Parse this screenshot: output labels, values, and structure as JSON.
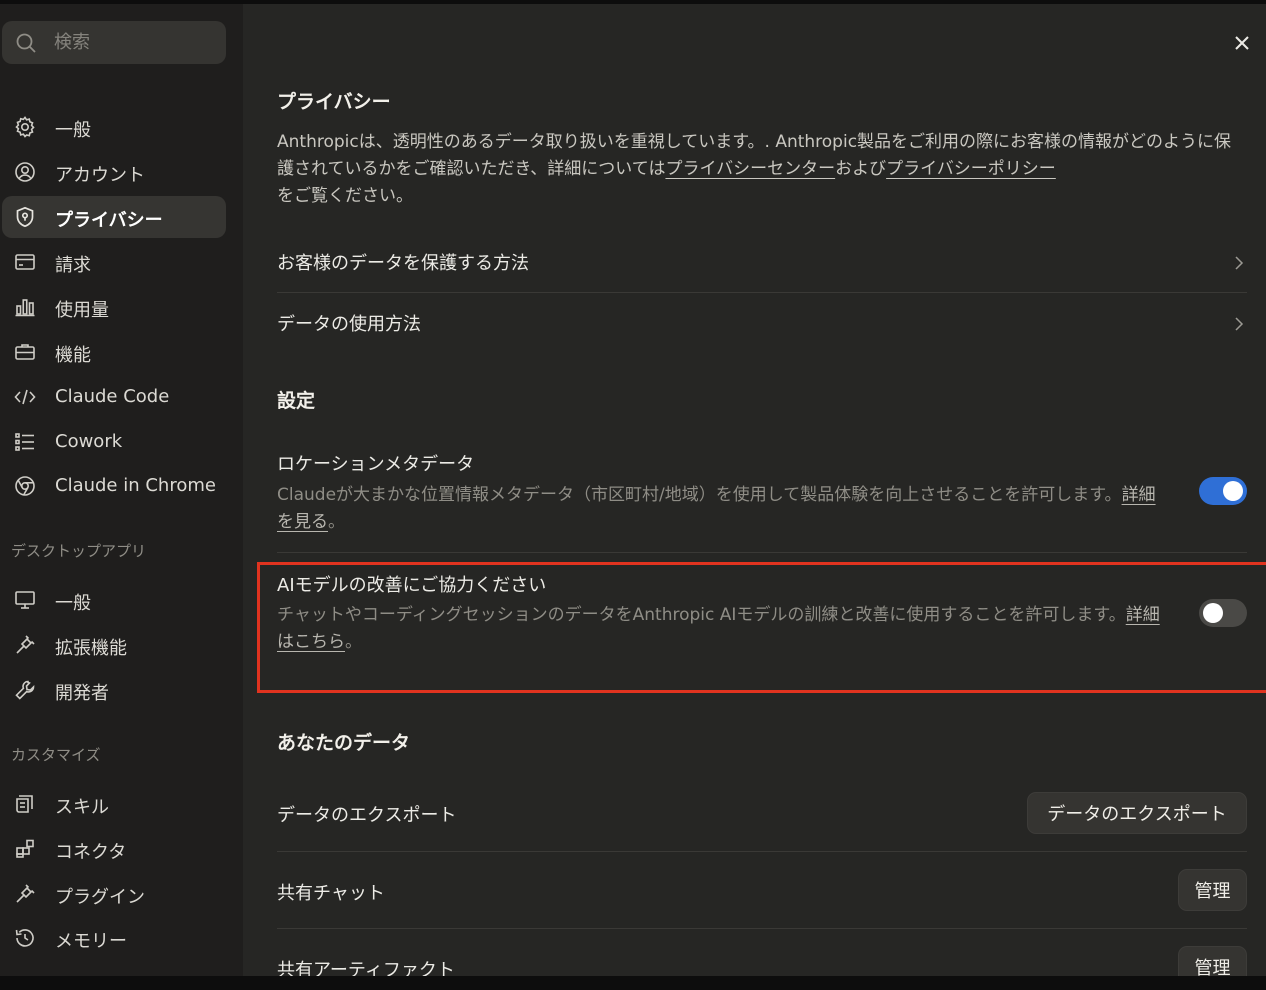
{
  "search": {
    "placeholder": "検索"
  },
  "sidebar": {
    "items": [
      {
        "label": "一般",
        "icon": "gear-icon"
      },
      {
        "label": "アカウント",
        "icon": "user-circle-icon"
      },
      {
        "label": "プライバシー",
        "icon": "shield-icon",
        "active": true
      },
      {
        "label": "請求",
        "icon": "credit-card-icon"
      },
      {
        "label": "使用量",
        "icon": "bar-chart-icon"
      },
      {
        "label": "機能",
        "icon": "briefcase-icon"
      },
      {
        "label": "Claude Code",
        "icon": "code-icon"
      },
      {
        "label": "Cowork",
        "icon": "list-icon"
      },
      {
        "label": "Claude in Chrome",
        "icon": "globe-icon"
      }
    ],
    "desktop_section": "デスクトップアプリ",
    "desktop_items": [
      {
        "label": "一般",
        "icon": "monitor-icon"
      },
      {
        "label": "拡張機能",
        "icon": "plug-icon"
      },
      {
        "label": "開発者",
        "icon": "wrench-icon"
      }
    ],
    "customize_section": "カスタマイズ",
    "customize_items": [
      {
        "label": "スキル",
        "icon": "scroll-icon"
      },
      {
        "label": "コネクタ",
        "icon": "blocks-icon"
      },
      {
        "label": "プラグイン",
        "icon": "plug-icon"
      },
      {
        "label": "メモリー",
        "icon": "history-icon"
      }
    ]
  },
  "privacy": {
    "title": "プライバシー",
    "intro_pre": "Anthropicは、透明性のあるデータ取り扱いを重視しています。. Anthropic製品をご利用の際にお客様の情報がどのように保護されているかをご確認いただき、詳細については",
    "link_center": "プライバシーセンター",
    "intro_mid": "および",
    "link_policy": "プライバシーポリシー",
    "intro_post": "をご覧ください。",
    "row_protect": "お客様のデータを保護する方法",
    "row_usage": "データの使用方法"
  },
  "settings": {
    "title": "設定",
    "location": {
      "title": "ロケーションメタデータ",
      "desc": "Claudeが大まかな位置情報メタデータ（市区町村/地域）を使用して製品体験を向上させることを許可します。",
      "link": "詳細を見る",
      "suffix": "。",
      "enabled": true
    },
    "model_improve": {
      "title": "AIモデルの改善にご協力ください",
      "desc": "チャットやコーディングセッションのデータをAnthropic AIモデルの訓練と改善に使用することを許可します。",
      "link": "詳細はこちら",
      "suffix": "。",
      "enabled": false
    }
  },
  "your_data": {
    "title": "あなたのデータ",
    "export_label": "データのエクスポート",
    "export_button": "データのエクスポート",
    "shared_chats_label": "共有チャット",
    "shared_chats_button": "管理",
    "shared_artifacts_label": "共有アーティファクト",
    "shared_artifacts_button": "管理"
  },
  "colors": {
    "accent_toggle": "#2f6fd6",
    "highlight_border": "#e0331f"
  }
}
